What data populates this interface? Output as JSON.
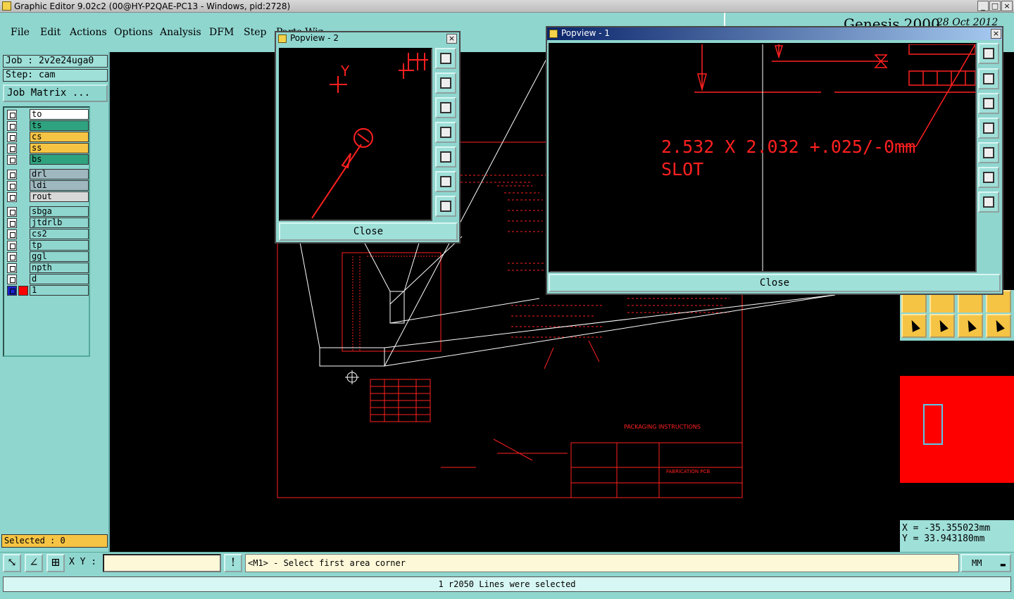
{
  "window": {
    "title": "Graphic Editor 9.02c2 (00@HY-P2QAE-PC13 - Windows, pid:2728)",
    "controls": [
      "_",
      "□",
      "×"
    ]
  },
  "menu": {
    "items": [
      "File",
      "Edit",
      "Actions",
      "Options",
      "Analysis",
      "DFM",
      "Step",
      "Parts Wiz"
    ]
  },
  "brand": {
    "name": "Genesis 2000",
    "date": "28 Oct 2012"
  },
  "job": {
    "job_label": "Job : 2v2e24uga0",
    "step_label": "Step: cam",
    "matrix_button": "Job Matrix ..."
  },
  "layers": {
    "group1": [
      {
        "name": "to",
        "color": "#ffffff"
      },
      {
        "name": "ts",
        "color": "#2fa37f"
      },
      {
        "name": "cs",
        "color": "#f6c444"
      },
      {
        "name": "ss",
        "color": "#f6c444"
      },
      {
        "name": "bs",
        "color": "#2fa37f"
      }
    ],
    "group2": [
      {
        "name": "drl",
        "color": "#9fb8c0"
      },
      {
        "name": "ldi",
        "color": "#9fb8c0"
      },
      {
        "name": "rout",
        "color": "#d8d8d8"
      }
    ],
    "group3": [
      {
        "name": "sbga",
        "color": "#8fd6cf"
      },
      {
        "name": "jtdrlb",
        "color": "#8fd6cf"
      },
      {
        "name": "cs2",
        "color": "#8fd6cf"
      },
      {
        "name": "tp",
        "color": "#8fd6cf"
      },
      {
        "name": "ggl",
        "color": "#8fd6cf"
      },
      {
        "name": "npth",
        "color": "#8fd6cf"
      },
      {
        "name": "d",
        "color": "#8fd6cf"
      },
      {
        "name": "1",
        "color": "#8fd6cf"
      }
    ]
  },
  "selected": "Selected : 0",
  "popview2": {
    "title": "Popview - 2",
    "close_label": "Close",
    "axis_label": "Y"
  },
  "popview1": {
    "title": "Popview - 1",
    "close_label": "Close",
    "dimension_text": "2.532 X 2.032 +.025/-0mm",
    "slot_text": "SLOT"
  },
  "drawing": {
    "packaging_title": "PACKAGING INSTRUCTIONS",
    "fab_title": "FABRICATION PCB"
  },
  "coords": {
    "x": "X = -35.355023mm",
    "y": "Y = 33.943180mm"
  },
  "command": {
    "xy_label": "X Y :",
    "xy_value": "",
    "prompt": "<M1> - Select first area corner",
    "units": "MM"
  },
  "status": "1 r2050 Lines were selected",
  "colors": {
    "background": "#8fd6cf",
    "canvas": "#000000",
    "drawing": "#ff2020",
    "highlight": "#f6c444"
  }
}
